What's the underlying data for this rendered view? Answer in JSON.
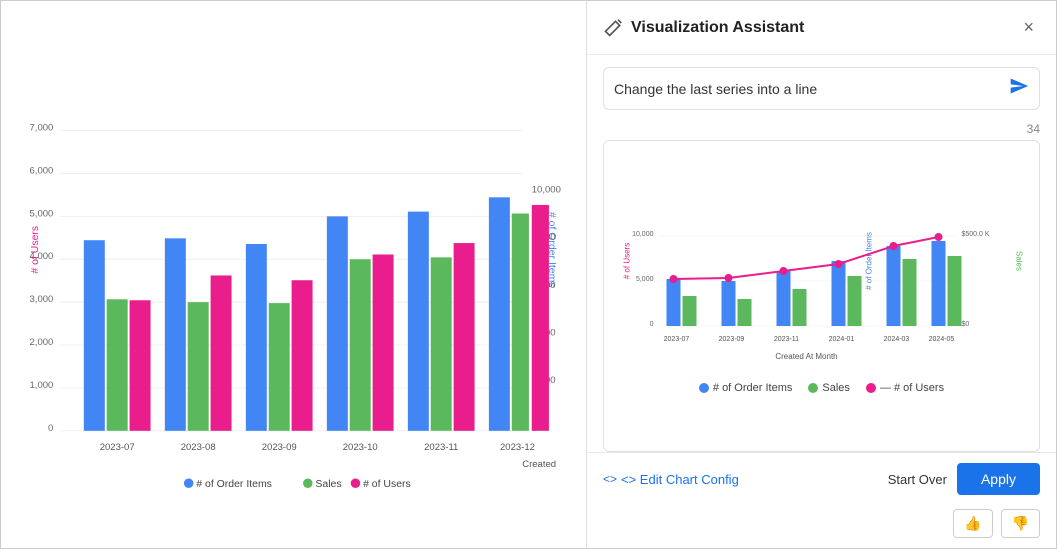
{
  "panel": {
    "title": "Visualization Assistant",
    "close_label": "×",
    "query": "Change the last series into a line",
    "char_count": "34",
    "edit_config_label": "<> Edit Chart Config",
    "start_over_label": "Start Over",
    "apply_label": "Apply"
  },
  "legend": {
    "items": [
      {
        "id": "order-items",
        "label": "# of Order Items",
        "color": "#4285f4",
        "type": "circle"
      },
      {
        "id": "sales",
        "label": "Sales",
        "color": "#5cb85c",
        "type": "circle"
      },
      {
        "id": "users",
        "label": "# of Users",
        "color": "#e91e8c",
        "type": "circle-line"
      }
    ]
  },
  "main_chart": {
    "x_label": "Created",
    "y_left_label": "# of Users",
    "y_right_label": "# of Order Items",
    "months": [
      "2023-07",
      "2023-08",
      "2023-09",
      "2023-10",
      "2023-11",
      "2023-12"
    ]
  },
  "preview_chart": {
    "x_label": "Created At Month",
    "y_left_label": "# of Users",
    "y_right_label": "# of Order Items",
    "y_right2_label": "Sales",
    "months": [
      "2023-07",
      "2023-09",
      "2023-11",
      "2024-01",
      "2024-03",
      "2024-05"
    ],
    "sales_label": "$500.0 K",
    "sales_bottom": "$0"
  },
  "icons": {
    "wand": "✏️",
    "send": "➤",
    "thumbs_up": "👍",
    "thumbs_down": "👎",
    "edit_code": "<>"
  }
}
